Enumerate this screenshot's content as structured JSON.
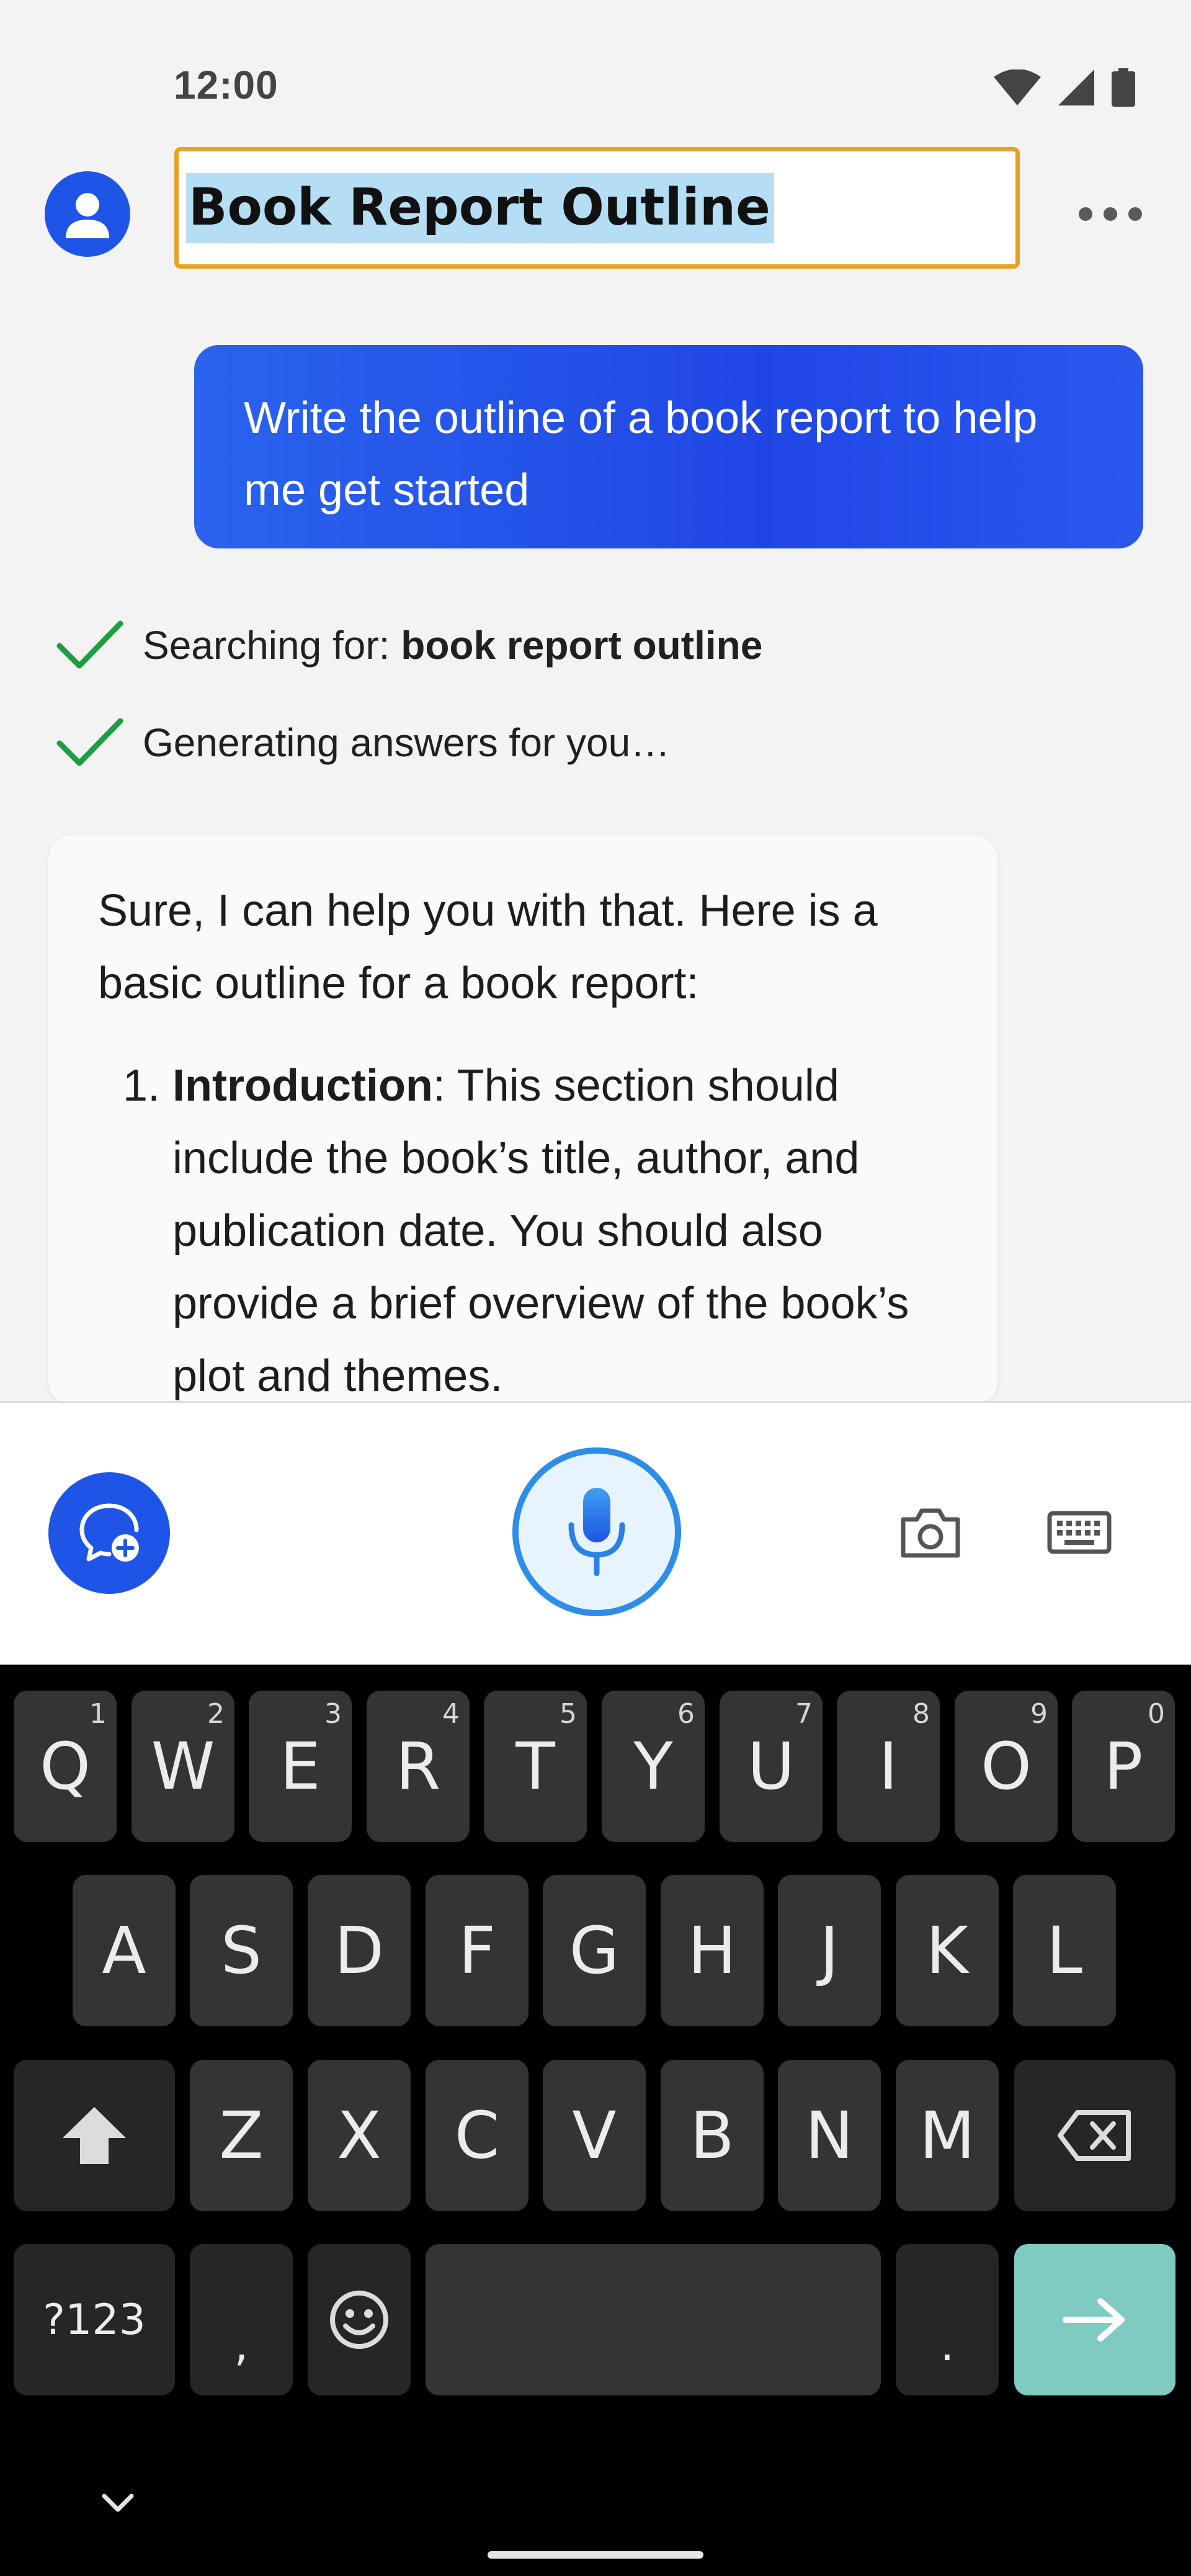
{
  "status_bar": {
    "time": "12:00",
    "icons": [
      "wifi-icon",
      "cell-signal-icon",
      "battery-icon"
    ]
  },
  "header": {
    "title": "Book Report Outline",
    "avatar_icon": "user-avatar-icon",
    "more_icon": "more-horizontal-icon"
  },
  "chat": {
    "user_message": "Write the outline of a book report to help me get started",
    "progress": [
      {
        "prefix": "Searching for: ",
        "bold": "book report outline",
        "icon": "check-icon"
      },
      {
        "prefix": "Generating answers for you…",
        "bold": "",
        "icon": "check-icon"
      }
    ],
    "answer": {
      "intro": "Sure, I can help you with that. Here is a basic outline for a book report:",
      "items": [
        {
          "number": "1.",
          "title": "Introduction",
          "text": ": This section should include the book’s title, author, and publication date. You should also provide a brief overview of the book’s plot and themes."
        }
      ]
    }
  },
  "action_bar": {
    "new_chat_icon": "new-chat-icon",
    "mic_icon": "microphone-icon",
    "camera_icon": "camera-icon",
    "keyboard_icon": "keyboard-icon"
  },
  "keyboard": {
    "row1": [
      {
        "label": "Q",
        "hint": "1"
      },
      {
        "label": "W",
        "hint": "2"
      },
      {
        "label": "E",
        "hint": "3"
      },
      {
        "label": "R",
        "hint": "4"
      },
      {
        "label": "T",
        "hint": "5"
      },
      {
        "label": "Y",
        "hint": "6"
      },
      {
        "label": "U",
        "hint": "7"
      },
      {
        "label": "I",
        "hint": "8"
      },
      {
        "label": "O",
        "hint": "9"
      },
      {
        "label": "P",
        "hint": "0"
      }
    ],
    "row2": [
      "A",
      "S",
      "D",
      "F",
      "G",
      "H",
      "J",
      "K",
      "L"
    ],
    "row3": [
      "Z",
      "X",
      "C",
      "V",
      "B",
      "N",
      "M"
    ],
    "symbols_label": "?123",
    "comma_label": ",",
    "period_label": ".",
    "colors": {
      "key": "#343434",
      "background": "#000000",
      "enter": "#7fcbc1"
    }
  },
  "colors": {
    "accent_blue": "#1f55e6",
    "title_border": "#e6a223",
    "selection": "#b5def5",
    "check_green": "#1e9e3e",
    "mic_ring": "#2c8ee8"
  }
}
